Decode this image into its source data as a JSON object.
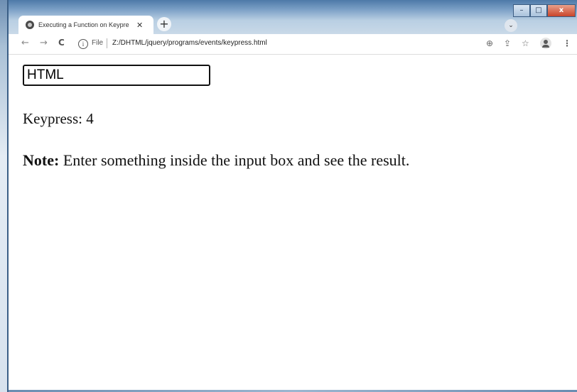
{
  "browser": {
    "tab": {
      "title": "Executing a Function on Keypress",
      "close_glyph": "✕",
      "favicon": "globe-icon"
    },
    "new_tab_glyph": "+",
    "tab_search_glyph": "⌄",
    "window_controls": {
      "minimize": "–",
      "maximize": "□",
      "close": "x"
    },
    "toolbar": {
      "back_glyph": "←",
      "forward_glyph": "→",
      "reload_glyph": "C",
      "info_glyph": "i",
      "scheme_label": "File",
      "url": "Z:/DHTML/jquery/programs/events/keypress.html",
      "zoom_glyph": "⊕",
      "share_glyph": "⇪",
      "bookmark_glyph": "☆",
      "menu_glyph": "⋮"
    }
  },
  "page": {
    "input_value": "HTML",
    "keypress_label": "Keypress:",
    "keypress_count": "4",
    "note_label": "Note:",
    "note_text": " Enter something inside the input box and see the result."
  }
}
